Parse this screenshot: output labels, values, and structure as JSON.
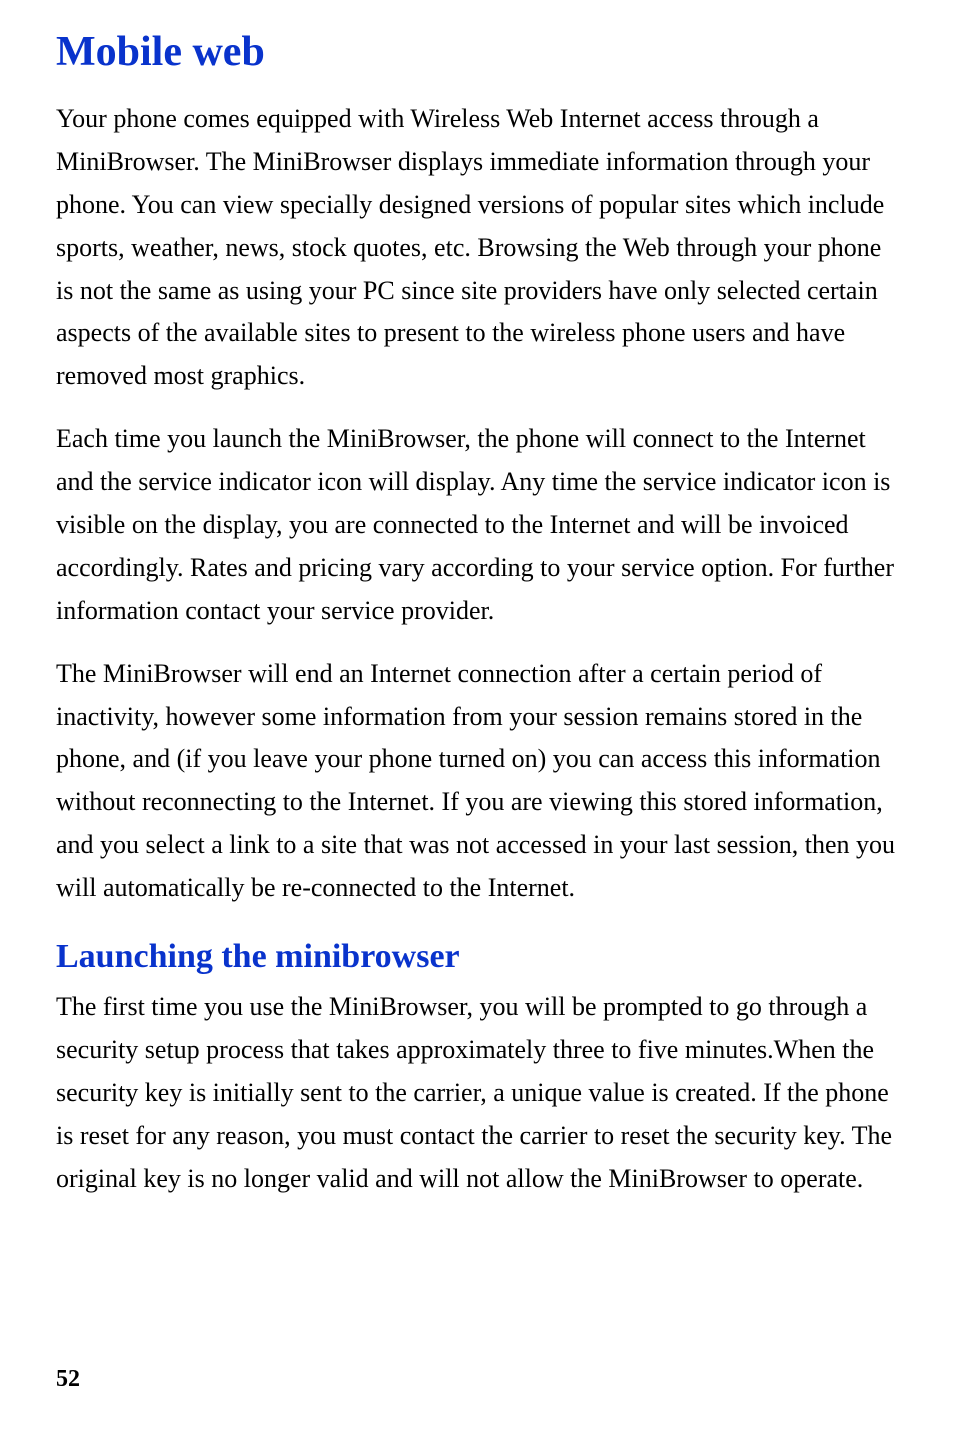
{
  "page": {
    "title": "Mobile web",
    "paragraphs": [
      "Your phone comes equipped with Wireless Web Internet access through a MiniBrowser. The MiniBrowser displays immediate information through your phone. You can view specially designed versions of popular sites which include sports, weather, news, stock quotes, etc. Browsing the Web through your phone is not the same as using your PC since site providers have only selected certain aspects of the available sites to present to the wireless phone users and have removed most graphics.",
      "Each time you launch the MiniBrowser, the phone will connect to the Internet and the service indicator icon will display. Any time the service indicator icon is visible on the display, you are connected to the Internet and will be invoiced accordingly. Rates and pricing vary according to your service option. For further information contact your service provider.",
      "The MiniBrowser will end an Internet connection after a certain period of inactivity, however some information from your session remains stored in the phone, and (if you leave your phone turned on) you can access this information without reconnecting to the Internet. If you are viewing this stored information, and you select a link to a site that was not accessed in your last session, then you will automatically be re-connected to the Internet."
    ],
    "section": {
      "heading": "Launching the minibrowser",
      "paragraph": "The first time you use the MiniBrowser, you will be prompted to go through a security setup process that takes approximately three to five minutes.When the security key is initially sent to the carrier, a unique value is created. If the phone is reset for any reason, you must contact the carrier to reset the security key. The original key is no longer valid and will not allow the MiniBrowser to operate."
    },
    "pageNumber": "52"
  }
}
